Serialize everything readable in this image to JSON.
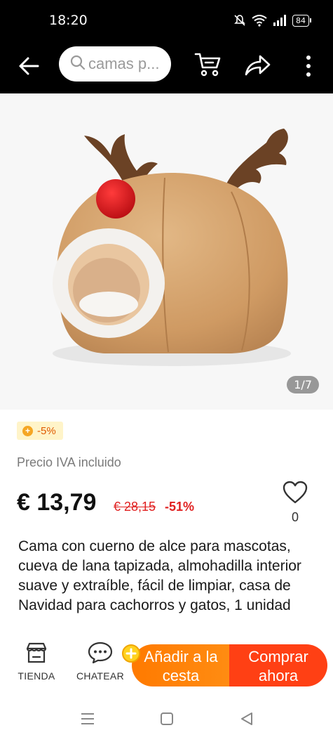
{
  "status_bar": {
    "time": "18:20",
    "battery": "84",
    "icons": [
      "mute-icon",
      "wifi-icon",
      "signal-icon",
      "battery-icon"
    ]
  },
  "top_bar": {
    "search_text": "camas p...",
    "icons": [
      "back-arrow-icon",
      "search-icon",
      "cart-icon",
      "share-icon",
      "more-icon"
    ]
  },
  "gallery": {
    "counter": "1/7"
  },
  "product": {
    "discount_badge": "-5%",
    "vat_note": "Precio IVA incluido",
    "price": "€ 13,79",
    "old_price": "€ 28,15",
    "discount_pct": "-51%",
    "wishlist_count": "0",
    "title": "Cama con cuerno de alce para mascotas, cueva de lana tapizada, almohadilla interior suave y extraíble, fácil de limpiar, casa de Navidad para cachorros y gatos, 1 unidad"
  },
  "bottom_bar": {
    "store_label": "TIENDA",
    "chat_label": "CHATEAR",
    "add_to_cart": "Añadir a la cesta",
    "buy_now": "Comprar ahora"
  },
  "colors": {
    "accent_orange": "#ff7a00",
    "accent_red": "#ff4014",
    "price_red": "#e02020",
    "badge_bg": "#fff4c9"
  }
}
